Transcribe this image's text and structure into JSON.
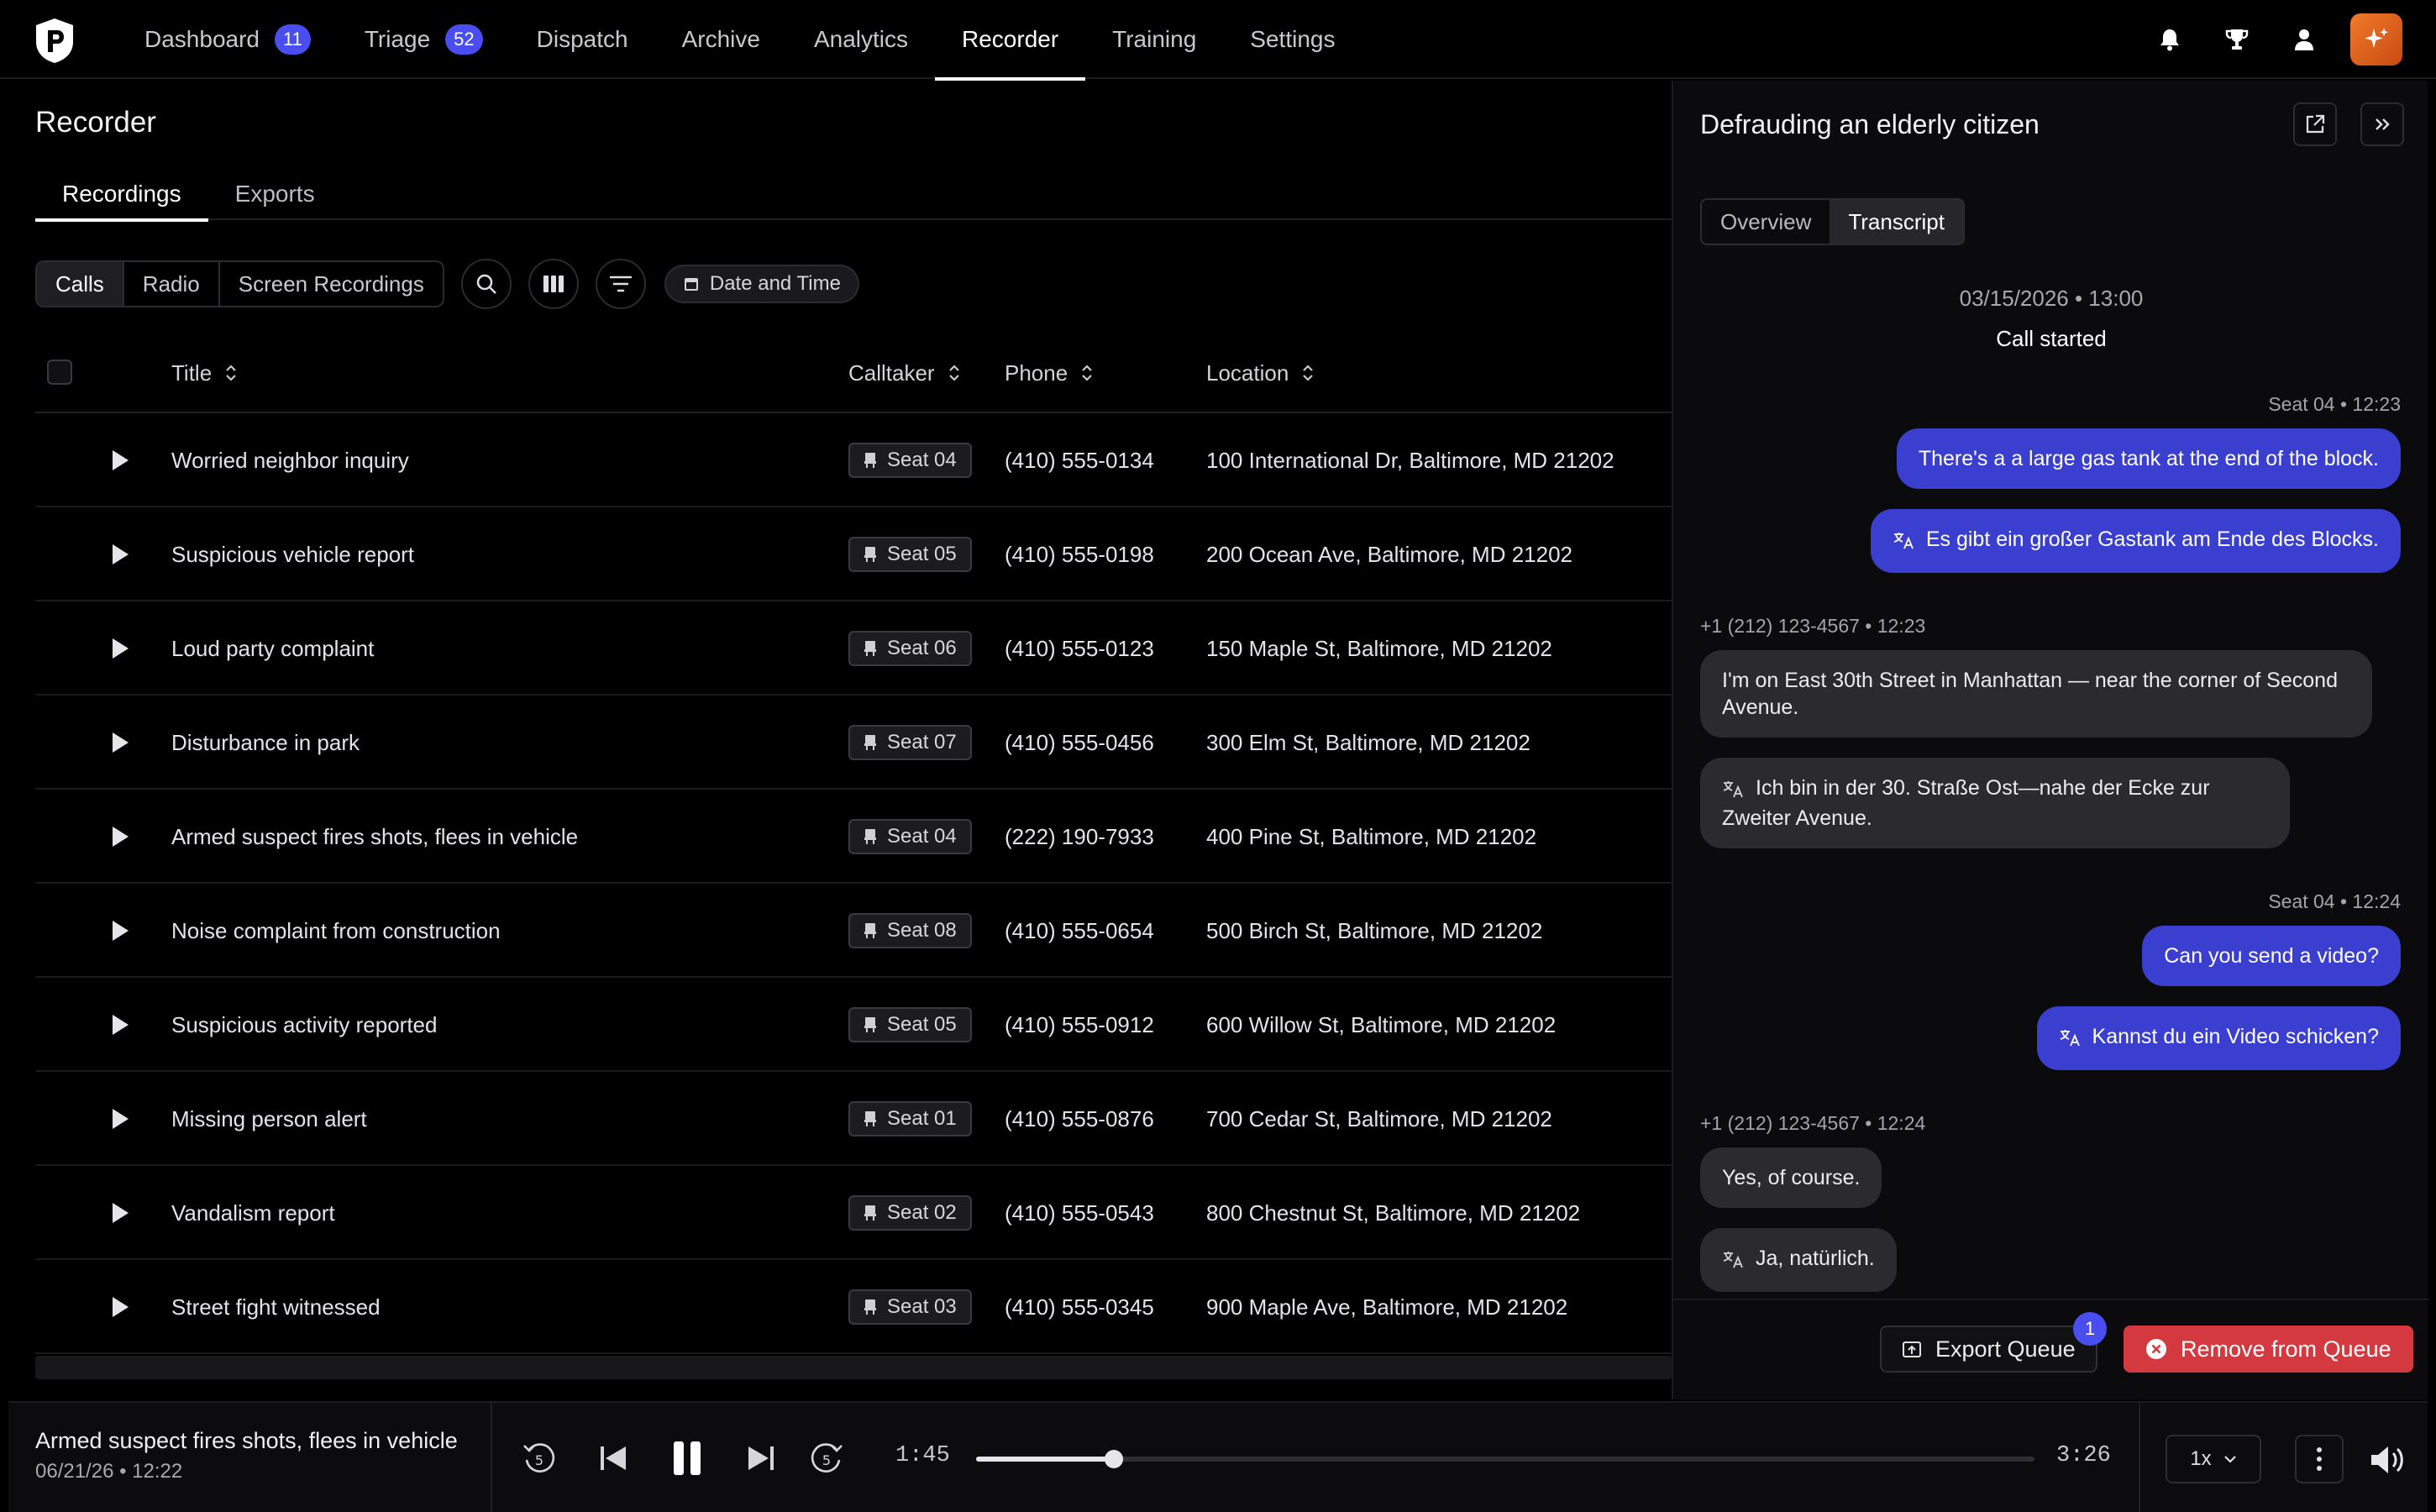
{
  "nav": {
    "items": [
      {
        "label": "Dashboard",
        "badge": "11",
        "active": false
      },
      {
        "label": "Triage",
        "badge": "52",
        "active": false
      },
      {
        "label": "Dispatch",
        "badge": null,
        "active": false
      },
      {
        "label": "Archive",
        "badge": null,
        "active": false
      },
      {
        "label": "Analytics",
        "badge": null,
        "active": false
      },
      {
        "label": "Recorder",
        "badge": null,
        "active": true
      },
      {
        "label": "Training",
        "badge": null,
        "active": false
      },
      {
        "label": "Settings",
        "badge": null,
        "active": false
      }
    ]
  },
  "page": {
    "title": "Recorder",
    "tabs": [
      {
        "label": "Recordings",
        "active": true
      },
      {
        "label": "Exports",
        "active": false
      }
    ]
  },
  "toolbar": {
    "segments": [
      {
        "label": "Calls",
        "active": true
      },
      {
        "label": "Radio",
        "active": false
      },
      {
        "label": "Screen Recordings",
        "active": false
      }
    ],
    "date_filter_label": "Date and Time"
  },
  "table": {
    "columns": {
      "title": "Title",
      "calltaker": "Calltaker",
      "phone": "Phone",
      "location": "Location"
    },
    "rows": [
      {
        "title": "Worried neighbor inquiry",
        "seat": "Seat 04",
        "phone": "(410) 555-0134",
        "location": "100 International Dr, Baltimore, MD 21202"
      },
      {
        "title": "Suspicious vehicle report",
        "seat": "Seat 05",
        "phone": "(410) 555-0198",
        "location": "200 Ocean Ave, Baltimore, MD 21202"
      },
      {
        "title": "Loud party complaint",
        "seat": "Seat 06",
        "phone": "(410) 555-0123",
        "location": "150 Maple St, Baltimore, MD 21202"
      },
      {
        "title": "Disturbance in park",
        "seat": "Seat 07",
        "phone": "(410) 555-0456",
        "location": "300 Elm St, Baltimore, MD 21202"
      },
      {
        "title": "Armed suspect fires shots, flees in vehicle",
        "seat": "Seat 04",
        "phone": "(222) 190-7933",
        "location": "400 Pine St, Baltimore, MD 21202"
      },
      {
        "title": "Noise complaint from construction",
        "seat": "Seat 08",
        "phone": "(410) 555-0654",
        "location": "500 Birch St, Baltimore, MD 21202"
      },
      {
        "title": "Suspicious activity reported",
        "seat": "Seat 05",
        "phone": "(410) 555-0912",
        "location": "600 Willow St, Baltimore, MD 21202"
      },
      {
        "title": "Missing person alert",
        "seat": "Seat 01",
        "phone": "(410) 555-0876",
        "location": "700 Cedar St, Baltimore, MD 21202"
      },
      {
        "title": "Vandalism report",
        "seat": "Seat 02",
        "phone": "(410) 555-0543",
        "location": "800 Chestnut St, Baltimore, MD 21202"
      },
      {
        "title": "Street fight witnessed",
        "seat": "Seat 03",
        "phone": "(410) 555-0345",
        "location": "900 Maple Ave, Baltimore, MD 21202"
      }
    ]
  },
  "panel": {
    "title": "Defrauding an elderly citizen",
    "tabs": [
      {
        "label": "Overview",
        "active": false
      },
      {
        "label": "Transcript",
        "active": true
      }
    ],
    "transcript": {
      "date": "03/15/2026 • 13:00",
      "started": "Call started",
      "meta_1": "Seat 04 • 12:23",
      "msg_1": "There's a a large gas tank at the end of the block.",
      "msg_1_tr": "Es gibt ein großer Gastank am Ende des Blocks.",
      "meta_2": "+1 (212) 123-4567 • 12:23",
      "msg_2": "I'm on East 30th Street in Manhattan — near the corner of Second Avenue.",
      "msg_2_tr": "Ich bin in der 30. Straße Ost—nahe der Ecke zur Zweiter Avenue.",
      "meta_3": "Seat 04 • 12:24",
      "msg_3": "Can you send a video?",
      "msg_3_tr": "Kannst du ein Video schicken?",
      "meta_4": "+1 (212) 123-4567 • 12:24",
      "msg_4": "Yes, of course.",
      "msg_4_tr": "Ja, natürlich."
    },
    "export_label": "Export Queue",
    "export_count": "1",
    "remove_label": "Remove from Queue"
  },
  "player": {
    "title": "Armed suspect fires shots, flees in vehicle",
    "date": "06/21/26 • 12:22",
    "elapsed": "1:45",
    "duration": "3:26",
    "progress_fraction": 0.13,
    "speed": "1x"
  },
  "colors": {
    "accent": "#4a4ef0",
    "outgoing_bubble": "#3a3fcf",
    "danger": "#d3393f",
    "brand_ai": "#f07a2a"
  }
}
